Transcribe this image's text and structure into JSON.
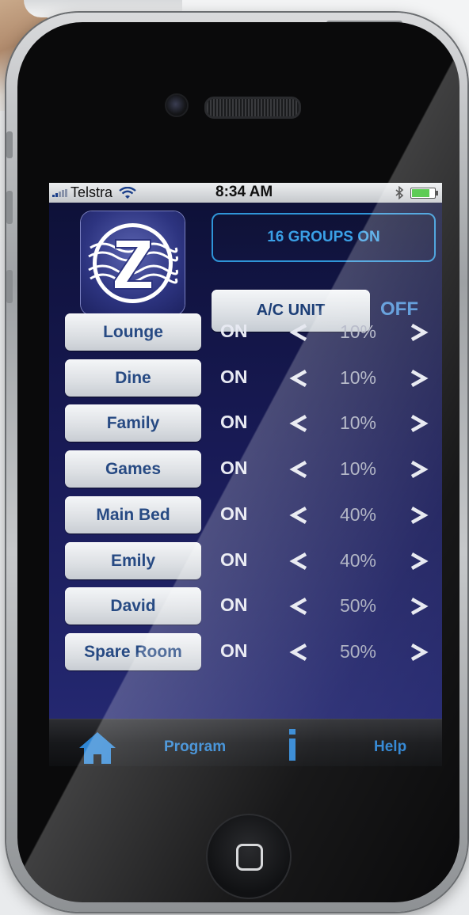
{
  "status_bar": {
    "carrier": "Telstra",
    "time": "8:34 AM",
    "icons": [
      "signal-icon",
      "wifi-icon",
      "bluetooth-icon",
      "battery-icon"
    ],
    "battery_level": 0.85
  },
  "app": {
    "logo_icon": "z-wave-logo",
    "groups_label": "16 GROUPS ON",
    "ac": {
      "label": "A/C UNIT",
      "state": "OFF"
    }
  },
  "rooms": [
    {
      "name": "Lounge",
      "state": "ON",
      "level": "10%"
    },
    {
      "name": "Dine",
      "state": "ON",
      "level": "10%"
    },
    {
      "name": "Family",
      "state": "ON",
      "level": "10%"
    },
    {
      "name": "Games",
      "state": "ON",
      "level": "10%"
    },
    {
      "name": "Main Bed",
      "state": "ON",
      "level": "40%"
    },
    {
      "name": "Emily",
      "state": "ON",
      "level": "40%"
    },
    {
      "name": "David",
      "state": "ON",
      "level": "50%"
    },
    {
      "name": "Spare Room",
      "state": "ON",
      "level": "50%"
    }
  ],
  "tab_bar": {
    "home_icon": "home-icon",
    "program_label": "Program",
    "info_icon": "info-icon",
    "help_label": "Help"
  },
  "colors": {
    "accent_blue": "#2f86d4",
    "button_text": "#274a83",
    "screen_bg": "#181a55",
    "groups_border": "#2f95d8"
  }
}
